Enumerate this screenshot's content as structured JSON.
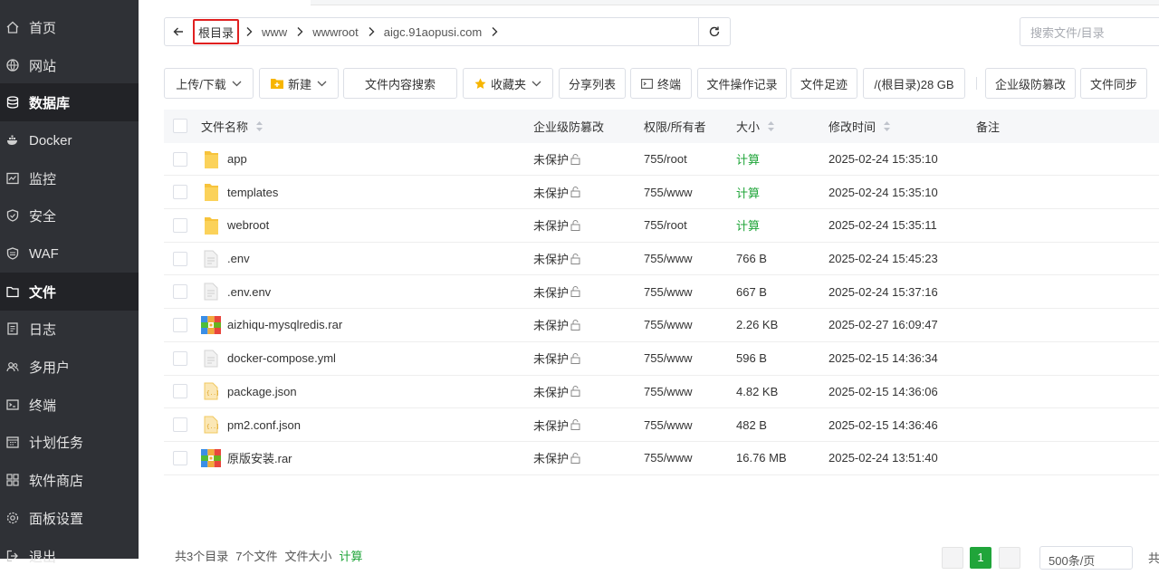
{
  "sidebar": {
    "items": [
      {
        "label": "首页",
        "icon": "home-icon"
      },
      {
        "label": "网站",
        "icon": "globe-icon"
      },
      {
        "label": "数据库",
        "icon": "database-icon",
        "active": true
      },
      {
        "label": "Docker",
        "icon": "docker-icon"
      },
      {
        "label": "监控",
        "icon": "monitor-icon"
      },
      {
        "label": "安全",
        "icon": "shield-icon"
      },
      {
        "label": "WAF",
        "icon": "waf-shield-icon"
      },
      {
        "label": "文件",
        "icon": "folder-icon",
        "active": true
      },
      {
        "label": "日志",
        "icon": "log-icon"
      },
      {
        "label": "多用户",
        "icon": "users-icon"
      },
      {
        "label": "终端",
        "icon": "terminal-icon"
      },
      {
        "label": "计划任务",
        "icon": "calendar-icon"
      },
      {
        "label": "软件商店",
        "icon": "grid-icon"
      },
      {
        "label": "面板设置",
        "icon": "gear-icon"
      },
      {
        "label": "退出",
        "icon": "logout-icon"
      }
    ]
  },
  "breadcrumb": {
    "root": "根目录",
    "segments": [
      "www",
      "wwwroot",
      "aigc.91aopusi.com"
    ]
  },
  "search": {
    "placeholder": "搜索文件/目录"
  },
  "toolbar": {
    "upload": "上传/下载",
    "new": "新建",
    "content_search": "文件内容搜索",
    "favorites": "收藏夹",
    "share_list": "分享列表",
    "terminal": "终端",
    "op_log": "文件操作记录",
    "footprint": "文件足迹",
    "disk": "/(根目录)28 GB",
    "tamper": "企业级防篡改",
    "sync": "文件同步"
  },
  "table": {
    "headers": {
      "name": "文件名称",
      "protect": "企业级防篡改",
      "perm": "权限/所有者",
      "size": "大小",
      "mtime": "修改时间",
      "note": "备注"
    },
    "rows": [
      {
        "name": "app",
        "type": "folder",
        "protect": "未保护",
        "perm": "755/root",
        "size": "计算",
        "size_link": true,
        "mtime": "2025-02-24 15:35:10"
      },
      {
        "name": "templates",
        "type": "folder",
        "protect": "未保护",
        "perm": "755/www",
        "size": "计算",
        "size_link": true,
        "mtime": "2025-02-24 15:35:10"
      },
      {
        "name": "webroot",
        "type": "folder",
        "protect": "未保护",
        "perm": "755/root",
        "size": "计算",
        "size_link": true,
        "mtime": "2025-02-24 15:35:11"
      },
      {
        "name": ".env",
        "type": "file",
        "protect": "未保护",
        "perm": "755/www",
        "size": "766 B",
        "size_link": false,
        "mtime": "2025-02-24 15:45:23"
      },
      {
        "name": ".env.env",
        "type": "file",
        "protect": "未保护",
        "perm": "755/www",
        "size": "667 B",
        "size_link": false,
        "mtime": "2025-02-24 15:37:16"
      },
      {
        "name": "aizhiqu-mysqlredis.rar",
        "type": "rar",
        "protect": "未保护",
        "perm": "755/www",
        "size": "2.26 KB",
        "size_link": false,
        "mtime": "2025-02-27 16:09:47"
      },
      {
        "name": "docker-compose.yml",
        "type": "file",
        "protect": "未保护",
        "perm": "755/www",
        "size": "596 B",
        "size_link": false,
        "mtime": "2025-02-15 14:36:34"
      },
      {
        "name": "package.json",
        "type": "json",
        "protect": "未保护",
        "perm": "755/www",
        "size": "4.82 KB",
        "size_link": false,
        "mtime": "2025-02-15 14:36:06"
      },
      {
        "name": "pm2.conf.json",
        "type": "json",
        "protect": "未保护",
        "perm": "755/www",
        "size": "482 B",
        "size_link": false,
        "mtime": "2025-02-15 14:36:46"
      },
      {
        "name": "原版安装.rar",
        "type": "rar",
        "protect": "未保护",
        "perm": "755/www",
        "size": "16.76 MB",
        "size_link": false,
        "mtime": "2025-02-24 13:51:40"
      }
    ]
  },
  "footer": {
    "dirs": "共3个目录",
    "files": "7个文件",
    "size_label": "文件大小",
    "size_link": "计算",
    "page": "1",
    "page_size": "500条/页",
    "total": "共"
  },
  "colors": {
    "sidebar_bg": "#2f3136",
    "accent_green": "#20a53a",
    "highlight_red": "#e02020"
  }
}
